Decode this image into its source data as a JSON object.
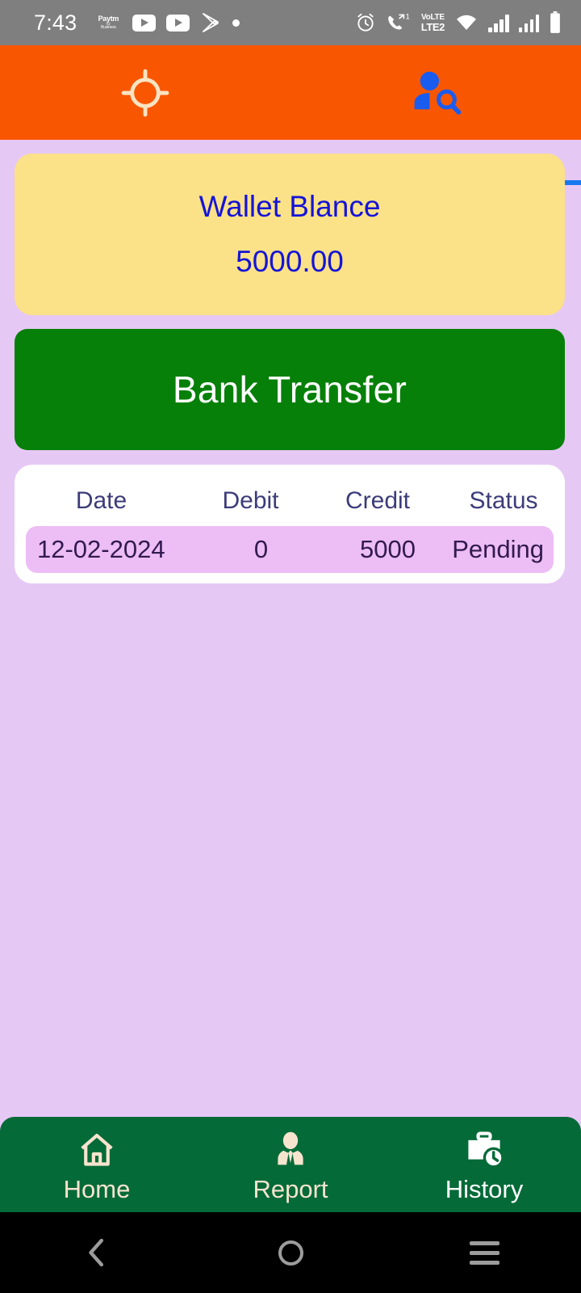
{
  "status_bar": {
    "time": "7:43",
    "left_icons": [
      "paytm-business-logo",
      "youtube-icon",
      "youtube-icon",
      "play-store-icon",
      "dot-indicator"
    ],
    "paytm": {
      "line1": "Paytm",
      "line2": "for",
      "line3": "Business"
    },
    "right_icons": [
      "alarm-icon",
      "missed-call-icon",
      "volte-icon",
      "wifi-icon",
      "signal-icon",
      "signal-icon",
      "battery-icon"
    ],
    "missed_call_badge": "1",
    "volte_top": "VoLTE",
    "volte_bottom": "LTE2"
  },
  "tabbar": {
    "background": "#F95601",
    "indicator_color": "#1878F0",
    "tabs": [
      {
        "icon": "crosshair-target-icon",
        "selected": false,
        "icon_color": "#FAE3C2"
      },
      {
        "icon": "person-search-icon",
        "selected": true,
        "icon_color": "#1A5CF0"
      }
    ]
  },
  "wallet": {
    "title": "Wallet Blance",
    "amount": "5000.00",
    "card_color": "#FBE188",
    "text_color": "#1414D8"
  },
  "bank_transfer": {
    "label": "Bank Transfer",
    "color": "#068009"
  },
  "transactions": {
    "columns": [
      "Date",
      "Debit",
      "Credit",
      "Status"
    ],
    "rows": [
      {
        "date": "12-02-2024",
        "debit": "0",
        "credit": "5000",
        "status": "Pending"
      }
    ],
    "row_color": "#EDBDF5"
  },
  "bottom_nav": {
    "background": "#046A38",
    "items": [
      {
        "label": "Home",
        "icon": "home-icon"
      },
      {
        "label": "Report",
        "icon": "person-tie-icon"
      },
      {
        "label": "History",
        "icon": "briefcase-clock-icon"
      }
    ]
  },
  "android_nav": {
    "buttons": [
      "back-icon",
      "home-circle-icon",
      "recents-icon"
    ]
  },
  "page_background": "#E6C8F5"
}
